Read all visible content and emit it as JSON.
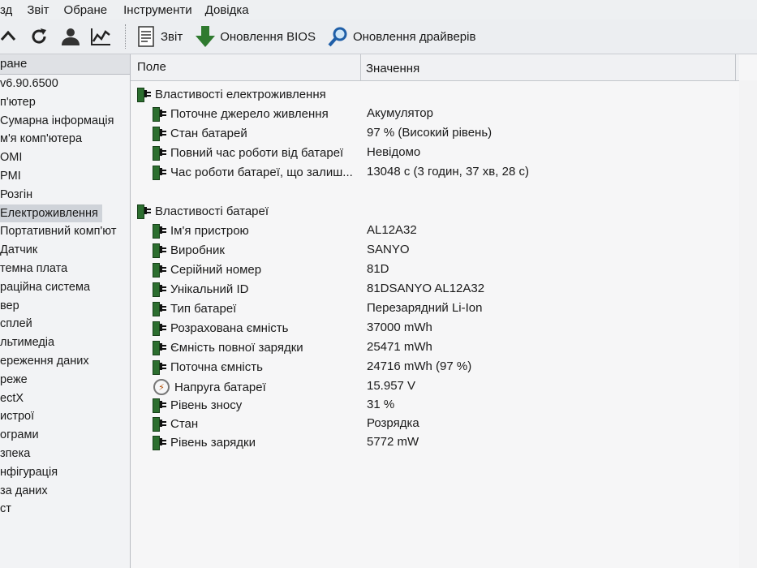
{
  "menu": [
    "зд",
    "Звіт",
    "Обране",
    "Інструменти",
    "Довідка"
  ],
  "toolbar": {
    "report_label": "Звіт",
    "bios_update_label": "Оновлення BIOS",
    "driver_update_label": "Оновлення драйверів"
  },
  "sidebar": {
    "header": "ране",
    "items": [
      "v6.90.6500",
      "п'ютер",
      "Сумарна інформація",
      "м'я комп'ютера",
      "OMI",
      "PMI",
      "Розгін",
      "Електроживлення",
      "Портативний комп'ют",
      "Датчик",
      "темна плата",
      "раційна система",
      "вер",
      "сплей",
      "льтимедіа",
      "ереження даних",
      "реже",
      "ectX",
      "истрої",
      "ограми",
      "зпека",
      "нфігурація",
      "за даних",
      "ст"
    ],
    "selected_index": 7
  },
  "columns": {
    "field": "Поле",
    "value": "Значення"
  },
  "rows": [
    {
      "type": "group",
      "label": "Властивості електроживлення",
      "icon": "battery-icon"
    },
    {
      "type": "item",
      "label": "Поточне джерело живлення",
      "value": "Акумулятор",
      "icon": "battery-icon"
    },
    {
      "type": "item",
      "label": "Стан батарей",
      "value": "97 % (Високий рівень)",
      "icon": "battery-icon"
    },
    {
      "type": "item",
      "label": "Повний час роботи від батареї",
      "value": "Невідомо",
      "icon": "battery-icon"
    },
    {
      "type": "item",
      "label": "Час роботи батареї, що залиш...",
      "value": "13048 с (3 годин, 37 хв, 28 с)",
      "icon": "battery-icon"
    },
    {
      "type": "group",
      "label": "Властивості батареї",
      "icon": "battery-icon"
    },
    {
      "type": "item",
      "label": "Ім'я пристрою",
      "value": "AL12A32",
      "icon": "battery-icon"
    },
    {
      "type": "item",
      "label": "Виробник",
      "value": "SANYO",
      "icon": "battery-icon"
    },
    {
      "type": "item",
      "label": "Серійний номер",
      "value": "81D",
      "icon": "battery-icon"
    },
    {
      "type": "item",
      "label": "Унікальний ID",
      "value": "81DSANYO AL12A32",
      "icon": "battery-icon"
    },
    {
      "type": "item",
      "label": "Тип батареї",
      "value": "Перезарядний Li-Ion",
      "icon": "battery-icon"
    },
    {
      "type": "item",
      "label": "Розрахована ємність",
      "value": "37000 mWh",
      "icon": "battery-icon"
    },
    {
      "type": "item",
      "label": "Ємність повної зарядки",
      "value": "25471 mWh",
      "icon": "battery-icon"
    },
    {
      "type": "item",
      "label": "Поточна ємність",
      "value": "24716 mWh  (97 %)",
      "icon": "battery-icon"
    },
    {
      "type": "item",
      "label": "Напруга батареї",
      "value": "15.957 V",
      "icon": "voltage-icon"
    },
    {
      "type": "item",
      "label": "Рівень зносу",
      "value": "31 %",
      "icon": "battery-icon"
    },
    {
      "type": "item",
      "label": "Стан",
      "value": "Розрядка",
      "icon": "battery-icon"
    },
    {
      "type": "item",
      "label": "Рівень зарядки",
      "value": "5772 mW",
      "icon": "battery-icon"
    }
  ]
}
